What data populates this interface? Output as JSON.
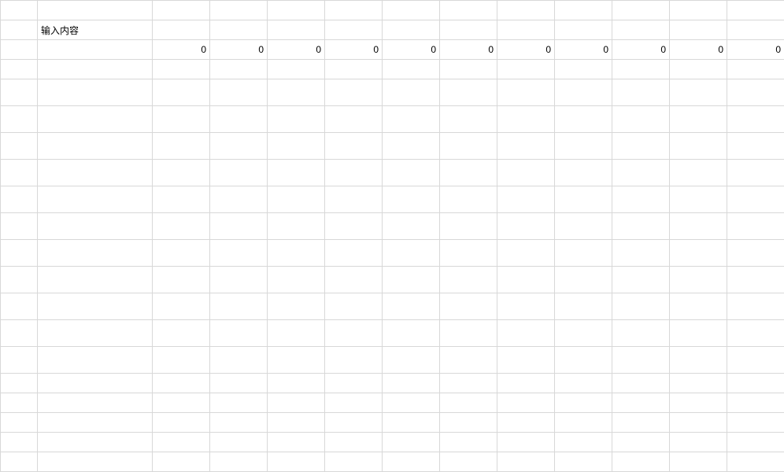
{
  "rows": [
    {
      "tall": false,
      "cells": [
        {
          "value": "",
          "align": "left"
        },
        {
          "value": "",
          "align": "left"
        },
        {
          "value": "",
          "align": "right"
        },
        {
          "value": "",
          "align": "right"
        },
        {
          "value": "",
          "align": "right"
        },
        {
          "value": "",
          "align": "right"
        },
        {
          "value": "",
          "align": "right"
        },
        {
          "value": "",
          "align": "right"
        },
        {
          "value": "",
          "align": "right"
        },
        {
          "value": "",
          "align": "right"
        },
        {
          "value": "",
          "align": "right"
        },
        {
          "value": "",
          "align": "right"
        },
        {
          "value": "",
          "align": "right"
        }
      ]
    },
    {
      "tall": false,
      "cells": [
        {
          "value": "",
          "align": "left"
        },
        {
          "value": "输入内容",
          "align": "left"
        },
        {
          "value": "",
          "align": "right"
        },
        {
          "value": "",
          "align": "right"
        },
        {
          "value": "",
          "align": "right"
        },
        {
          "value": "",
          "align": "right"
        },
        {
          "value": "",
          "align": "right"
        },
        {
          "value": "",
          "align": "right"
        },
        {
          "value": "",
          "align": "right"
        },
        {
          "value": "",
          "align": "right"
        },
        {
          "value": "",
          "align": "right"
        },
        {
          "value": "",
          "align": "right"
        },
        {
          "value": "",
          "align": "right"
        }
      ]
    },
    {
      "tall": false,
      "cells": [
        {
          "value": "",
          "align": "left"
        },
        {
          "value": "",
          "align": "left"
        },
        {
          "value": "0",
          "align": "right"
        },
        {
          "value": "0",
          "align": "right"
        },
        {
          "value": "0",
          "align": "right"
        },
        {
          "value": "0",
          "align": "right"
        },
        {
          "value": "0",
          "align": "right"
        },
        {
          "value": "0",
          "align": "right"
        },
        {
          "value": "0",
          "align": "right"
        },
        {
          "value": "0",
          "align": "right"
        },
        {
          "value": "0",
          "align": "right"
        },
        {
          "value": "0",
          "align": "right"
        },
        {
          "value": "0",
          "align": "right"
        }
      ]
    },
    {
      "tall": false,
      "cells": [
        {
          "value": "",
          "align": "left"
        },
        {
          "value": "",
          "align": "left"
        },
        {
          "value": "",
          "align": "right"
        },
        {
          "value": "",
          "align": "right"
        },
        {
          "value": "",
          "align": "right"
        },
        {
          "value": "",
          "align": "right"
        },
        {
          "value": "",
          "align": "right"
        },
        {
          "value": "",
          "align": "right"
        },
        {
          "value": "",
          "align": "right"
        },
        {
          "value": "",
          "align": "right"
        },
        {
          "value": "",
          "align": "right"
        },
        {
          "value": "",
          "align": "right"
        },
        {
          "value": "",
          "align": "right"
        }
      ]
    },
    {
      "tall": true,
      "cells": [
        {
          "value": "",
          "align": "left"
        },
        {
          "value": "",
          "align": "left"
        },
        {
          "value": "",
          "align": "right"
        },
        {
          "value": "",
          "align": "right"
        },
        {
          "value": "",
          "align": "right"
        },
        {
          "value": "",
          "align": "right"
        },
        {
          "value": "",
          "align": "right"
        },
        {
          "value": "",
          "align": "right"
        },
        {
          "value": "",
          "align": "right"
        },
        {
          "value": "",
          "align": "right"
        },
        {
          "value": "",
          "align": "right"
        },
        {
          "value": "",
          "align": "right"
        },
        {
          "value": "",
          "align": "right"
        }
      ]
    },
    {
      "tall": true,
      "cells": [
        {
          "value": "",
          "align": "left"
        },
        {
          "value": "",
          "align": "left"
        },
        {
          "value": "",
          "align": "right"
        },
        {
          "value": "",
          "align": "right"
        },
        {
          "value": "",
          "align": "right"
        },
        {
          "value": "",
          "align": "right"
        },
        {
          "value": "",
          "align": "right"
        },
        {
          "value": "",
          "align": "right"
        },
        {
          "value": "",
          "align": "right"
        },
        {
          "value": "",
          "align": "right"
        },
        {
          "value": "",
          "align": "right"
        },
        {
          "value": "",
          "align": "right"
        },
        {
          "value": "",
          "align": "right"
        }
      ]
    },
    {
      "tall": true,
      "cells": [
        {
          "value": "",
          "align": "left"
        },
        {
          "value": "",
          "align": "left"
        },
        {
          "value": "",
          "align": "right"
        },
        {
          "value": "",
          "align": "right"
        },
        {
          "value": "",
          "align": "right"
        },
        {
          "value": "",
          "align": "right"
        },
        {
          "value": "",
          "align": "right"
        },
        {
          "value": "",
          "align": "right"
        },
        {
          "value": "",
          "align": "right"
        },
        {
          "value": "",
          "align": "right"
        },
        {
          "value": "",
          "align": "right"
        },
        {
          "value": "",
          "align": "right"
        },
        {
          "value": "",
          "align": "right"
        }
      ]
    },
    {
      "tall": true,
      "cells": [
        {
          "value": "",
          "align": "left"
        },
        {
          "value": "",
          "align": "left"
        },
        {
          "value": "",
          "align": "right"
        },
        {
          "value": "",
          "align": "right"
        },
        {
          "value": "",
          "align": "right"
        },
        {
          "value": "",
          "align": "right"
        },
        {
          "value": "",
          "align": "right"
        },
        {
          "value": "",
          "align": "right"
        },
        {
          "value": "",
          "align": "right"
        },
        {
          "value": "",
          "align": "right"
        },
        {
          "value": "",
          "align": "right"
        },
        {
          "value": "",
          "align": "right"
        },
        {
          "value": "",
          "align": "right"
        }
      ]
    },
    {
      "tall": true,
      "cells": [
        {
          "value": "",
          "align": "left"
        },
        {
          "value": "",
          "align": "left"
        },
        {
          "value": "",
          "align": "right"
        },
        {
          "value": "",
          "align": "right"
        },
        {
          "value": "",
          "align": "right"
        },
        {
          "value": "",
          "align": "right"
        },
        {
          "value": "",
          "align": "right"
        },
        {
          "value": "",
          "align": "right"
        },
        {
          "value": "",
          "align": "right"
        },
        {
          "value": "",
          "align": "right"
        },
        {
          "value": "",
          "align": "right"
        },
        {
          "value": "",
          "align": "right"
        },
        {
          "value": "",
          "align": "right"
        }
      ]
    },
    {
      "tall": true,
      "cells": [
        {
          "value": "",
          "align": "left"
        },
        {
          "value": "",
          "align": "left"
        },
        {
          "value": "",
          "align": "right"
        },
        {
          "value": "",
          "align": "right"
        },
        {
          "value": "",
          "align": "right"
        },
        {
          "value": "",
          "align": "right"
        },
        {
          "value": "",
          "align": "right"
        },
        {
          "value": "",
          "align": "right"
        },
        {
          "value": "",
          "align": "right"
        },
        {
          "value": "",
          "align": "right"
        },
        {
          "value": "",
          "align": "right"
        },
        {
          "value": "",
          "align": "right"
        },
        {
          "value": "",
          "align": "right"
        }
      ]
    },
    {
      "tall": true,
      "cells": [
        {
          "value": "",
          "align": "left"
        },
        {
          "value": "",
          "align": "left"
        },
        {
          "value": "",
          "align": "right"
        },
        {
          "value": "",
          "align": "right"
        },
        {
          "value": "",
          "align": "right"
        },
        {
          "value": "",
          "align": "right"
        },
        {
          "value": "",
          "align": "right"
        },
        {
          "value": "",
          "align": "right"
        },
        {
          "value": "",
          "align": "right"
        },
        {
          "value": "",
          "align": "right"
        },
        {
          "value": "",
          "align": "right"
        },
        {
          "value": "",
          "align": "right"
        },
        {
          "value": "",
          "align": "right"
        }
      ]
    },
    {
      "tall": true,
      "cells": [
        {
          "value": "",
          "align": "left"
        },
        {
          "value": "",
          "align": "left"
        },
        {
          "value": "",
          "align": "right"
        },
        {
          "value": "",
          "align": "right"
        },
        {
          "value": "",
          "align": "right"
        },
        {
          "value": "",
          "align": "right"
        },
        {
          "value": "",
          "align": "right"
        },
        {
          "value": "",
          "align": "right"
        },
        {
          "value": "",
          "align": "right"
        },
        {
          "value": "",
          "align": "right"
        },
        {
          "value": "",
          "align": "right"
        },
        {
          "value": "",
          "align": "right"
        },
        {
          "value": "",
          "align": "right"
        }
      ]
    },
    {
      "tall": true,
      "cells": [
        {
          "value": "",
          "align": "left"
        },
        {
          "value": "",
          "align": "left"
        },
        {
          "value": "",
          "align": "right"
        },
        {
          "value": "",
          "align": "right"
        },
        {
          "value": "",
          "align": "right"
        },
        {
          "value": "",
          "align": "right"
        },
        {
          "value": "",
          "align": "right"
        },
        {
          "value": "",
          "align": "right"
        },
        {
          "value": "",
          "align": "right"
        },
        {
          "value": "",
          "align": "right"
        },
        {
          "value": "",
          "align": "right"
        },
        {
          "value": "",
          "align": "right"
        },
        {
          "value": "",
          "align": "right"
        }
      ]
    },
    {
      "tall": true,
      "cells": [
        {
          "value": "",
          "align": "left"
        },
        {
          "value": "",
          "align": "left"
        },
        {
          "value": "",
          "align": "right"
        },
        {
          "value": "",
          "align": "right"
        },
        {
          "value": "",
          "align": "right"
        },
        {
          "value": "",
          "align": "right"
        },
        {
          "value": "",
          "align": "right"
        },
        {
          "value": "",
          "align": "right"
        },
        {
          "value": "",
          "align": "right"
        },
        {
          "value": "",
          "align": "right"
        },
        {
          "value": "",
          "align": "right"
        },
        {
          "value": "",
          "align": "right"
        },
        {
          "value": "",
          "align": "right"
        }
      ]
    },
    {
      "tall": true,
      "cells": [
        {
          "value": "",
          "align": "left"
        },
        {
          "value": "",
          "align": "left"
        },
        {
          "value": "",
          "align": "right"
        },
        {
          "value": "",
          "align": "right"
        },
        {
          "value": "",
          "align": "right"
        },
        {
          "value": "",
          "align": "right"
        },
        {
          "value": "",
          "align": "right"
        },
        {
          "value": "",
          "align": "right"
        },
        {
          "value": "",
          "align": "right"
        },
        {
          "value": "",
          "align": "right"
        },
        {
          "value": "",
          "align": "right"
        },
        {
          "value": "",
          "align": "right"
        },
        {
          "value": "",
          "align": "right"
        }
      ]
    },
    {
      "tall": false,
      "cells": [
        {
          "value": "",
          "align": "left"
        },
        {
          "value": "",
          "align": "left"
        },
        {
          "value": "",
          "align": "right"
        },
        {
          "value": "",
          "align": "right"
        },
        {
          "value": "",
          "align": "right"
        },
        {
          "value": "",
          "align": "right"
        },
        {
          "value": "",
          "align": "right"
        },
        {
          "value": "",
          "align": "right"
        },
        {
          "value": "",
          "align": "right"
        },
        {
          "value": "",
          "align": "right"
        },
        {
          "value": "",
          "align": "right"
        },
        {
          "value": "",
          "align": "right"
        },
        {
          "value": "",
          "align": "right"
        }
      ]
    },
    {
      "tall": false,
      "cells": [
        {
          "value": "",
          "align": "left"
        },
        {
          "value": "",
          "align": "left"
        },
        {
          "value": "",
          "align": "right"
        },
        {
          "value": "",
          "align": "right"
        },
        {
          "value": "",
          "align": "right"
        },
        {
          "value": "",
          "align": "right"
        },
        {
          "value": "",
          "align": "right"
        },
        {
          "value": "",
          "align": "right"
        },
        {
          "value": "",
          "align": "right"
        },
        {
          "value": "",
          "align": "right"
        },
        {
          "value": "",
          "align": "right"
        },
        {
          "value": "",
          "align": "right"
        },
        {
          "value": "",
          "align": "right"
        }
      ]
    },
    {
      "tall": false,
      "cells": [
        {
          "value": "",
          "align": "left"
        },
        {
          "value": "",
          "align": "left"
        },
        {
          "value": "",
          "align": "right"
        },
        {
          "value": "",
          "align": "right"
        },
        {
          "value": "",
          "align": "right"
        },
        {
          "value": "",
          "align": "right"
        },
        {
          "value": "",
          "align": "right"
        },
        {
          "value": "",
          "align": "right"
        },
        {
          "value": "",
          "align": "right"
        },
        {
          "value": "",
          "align": "right"
        },
        {
          "value": "",
          "align": "right"
        },
        {
          "value": "",
          "align": "right"
        },
        {
          "value": "",
          "align": "right"
        }
      ]
    },
    {
      "tall": false,
      "cells": [
        {
          "value": "",
          "align": "left"
        },
        {
          "value": "",
          "align": "left"
        },
        {
          "value": "",
          "align": "right"
        },
        {
          "value": "",
          "align": "right"
        },
        {
          "value": "",
          "align": "right"
        },
        {
          "value": "",
          "align": "right"
        },
        {
          "value": "",
          "align": "right"
        },
        {
          "value": "",
          "align": "right"
        },
        {
          "value": "",
          "align": "right"
        },
        {
          "value": "",
          "align": "right"
        },
        {
          "value": "",
          "align": "right"
        },
        {
          "value": "",
          "align": "right"
        },
        {
          "value": "",
          "align": "right"
        }
      ]
    },
    {
      "tall": false,
      "cells": [
        {
          "value": "",
          "align": "left"
        },
        {
          "value": "",
          "align": "left"
        },
        {
          "value": "",
          "align": "right"
        },
        {
          "value": "",
          "align": "right"
        },
        {
          "value": "",
          "align": "right"
        },
        {
          "value": "",
          "align": "right"
        },
        {
          "value": "",
          "align": "right"
        },
        {
          "value": "",
          "align": "right"
        },
        {
          "value": "",
          "align": "right"
        },
        {
          "value": "",
          "align": "right"
        },
        {
          "value": "",
          "align": "right"
        },
        {
          "value": "",
          "align": "right"
        },
        {
          "value": "",
          "align": "right"
        }
      ]
    }
  ]
}
